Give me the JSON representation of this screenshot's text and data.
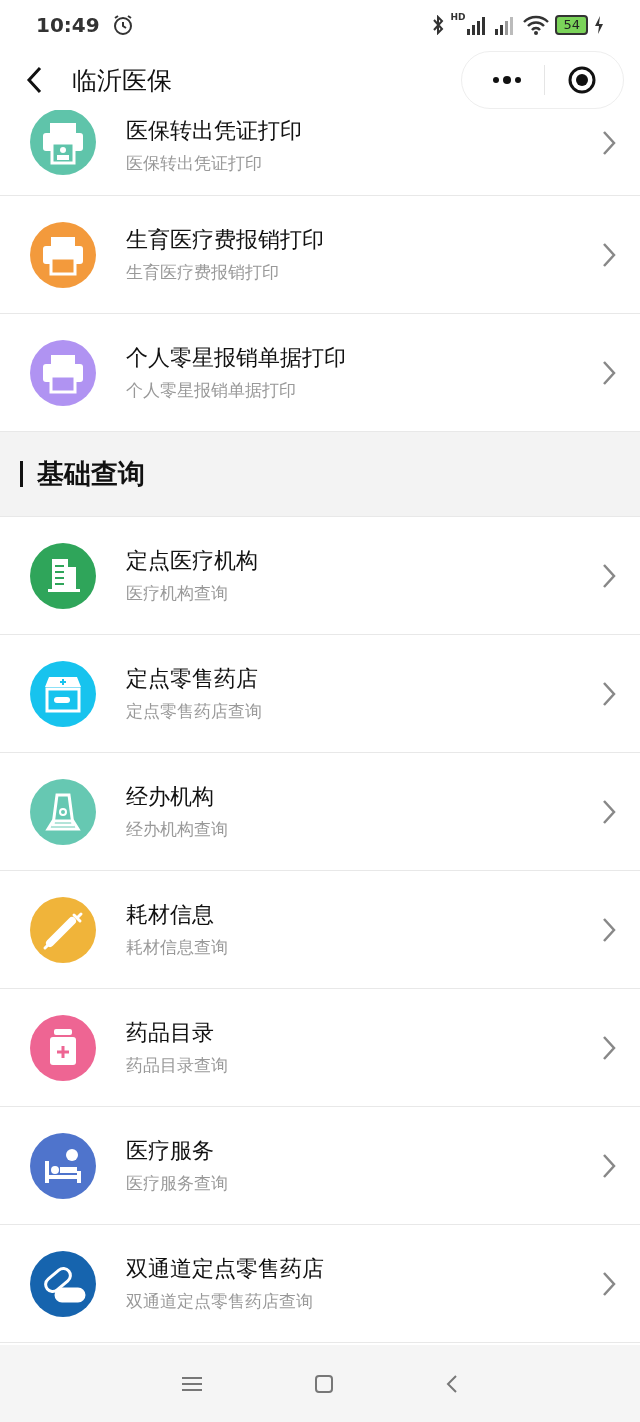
{
  "status_bar": {
    "time": "10:49",
    "network_label": "HD",
    "battery": "54"
  },
  "nav": {
    "title": "临沂医保"
  },
  "items_top": [
    {
      "kind": "printer-photo",
      "color": "#5fc4aa",
      "title": "医保转出凭证打印",
      "subtitle": "医保转出凭证打印"
    },
    {
      "kind": "printer",
      "color": "#f39a3c",
      "title": "生育医疗费报销打印",
      "subtitle": "生育医疗费报销打印"
    },
    {
      "kind": "printer",
      "color": "#b093f2",
      "title": "个人零星报销单据打印",
      "subtitle": "个人零星报销单据打印"
    }
  ],
  "section": {
    "title": "基础查询"
  },
  "items": [
    {
      "kind": "building",
      "color": "#2fa55a",
      "title": "定点医疗机构",
      "subtitle": "医疗机构查询"
    },
    {
      "kind": "store",
      "color": "#17c3ee",
      "title": "定点零售药店",
      "subtitle": "定点零售药店查询"
    },
    {
      "kind": "institution",
      "color": "#66c8b2",
      "title": "经办机构",
      "subtitle": "经办机构查询"
    },
    {
      "kind": "syringe",
      "color": "#f0b43a",
      "title": "耗材信息",
      "subtitle": "耗材信息查询"
    },
    {
      "kind": "bottle",
      "color": "#ee6593",
      "title": "药品目录",
      "subtitle": "药品目录查询"
    },
    {
      "kind": "bed",
      "color": "#4f74cc",
      "title": "医疗服务",
      "subtitle": "医疗服务查询"
    },
    {
      "kind": "capsule",
      "color": "#1664ae",
      "title": "双通道定点零售药店",
      "subtitle": "双通道定点零售药店查询"
    }
  ]
}
